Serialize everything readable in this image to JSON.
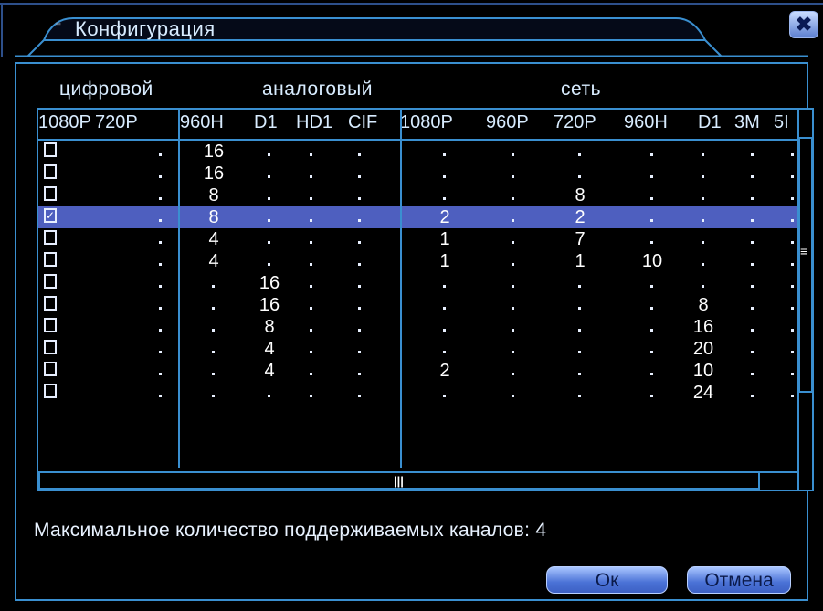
{
  "window": {
    "title": "Конфигурация",
    "close_label": "✖"
  },
  "groups": {
    "digital": "цифровой",
    "analog": "аналоговый",
    "network": "сеть"
  },
  "columns": [
    "1080P",
    "720P",
    "960H",
    "D1",
    "HD1",
    "CIF",
    "1080P",
    "960P",
    "720P",
    "960H",
    "D1",
    "3M",
    "5I"
  ],
  "rows": [
    {
      "checked": false,
      "values": [
        "",
        "",
        "16",
        "",
        "",
        "",
        "",
        "",
        "",
        "",
        "",
        "",
        ""
      ]
    },
    {
      "checked": false,
      "values": [
        "",
        "",
        "16",
        "",
        "",
        "",
        "",
        "",
        "",
        "",
        "",
        "",
        ""
      ]
    },
    {
      "checked": false,
      "values": [
        "",
        "",
        "8",
        "",
        "",
        "",
        "",
        "",
        "8",
        "",
        "",
        "",
        ""
      ]
    },
    {
      "checked": true,
      "values": [
        "",
        "",
        "8",
        "",
        "",
        "",
        "2",
        "",
        "2",
        "",
        "",
        "",
        ""
      ]
    },
    {
      "checked": false,
      "values": [
        "",
        "",
        "4",
        "",
        "",
        "",
        "1",
        "",
        "7",
        "",
        "",
        "",
        ""
      ]
    },
    {
      "checked": false,
      "values": [
        "",
        "",
        "4",
        "",
        "",
        "",
        "1",
        "",
        "1",
        "10",
        "",
        "",
        ""
      ]
    },
    {
      "checked": false,
      "values": [
        "",
        "",
        "",
        "16",
        "",
        "",
        "",
        "",
        "",
        "",
        "",
        "",
        ""
      ]
    },
    {
      "checked": false,
      "values": [
        "",
        "",
        "",
        "16",
        "",
        "",
        "",
        "",
        "",
        "",
        "8",
        "",
        ""
      ]
    },
    {
      "checked": false,
      "values": [
        "",
        "",
        "",
        "8",
        "",
        "",
        "",
        "",
        "",
        "",
        "16",
        "",
        ""
      ]
    },
    {
      "checked": false,
      "values": [
        "",
        "",
        "",
        "4",
        "",
        "",
        "",
        "",
        "",
        "",
        "20",
        "",
        ""
      ]
    },
    {
      "checked": false,
      "values": [
        "",
        "",
        "",
        "4",
        "",
        "",
        "2",
        "",
        "",
        "",
        "10",
        "",
        ""
      ]
    },
    {
      "checked": false,
      "values": [
        "",
        "",
        "",
        "",
        "",
        "",
        "",
        "",
        "",
        "",
        "24",
        "",
        ""
      ]
    }
  ],
  "status_text": "Максимальное количество поддерживаемых каналов: 4",
  "buttons": {
    "ok": "Ок",
    "cancel": "Отмена"
  },
  "colors": {
    "accent_blue": "#3a8fd0",
    "selection": "#4e5fbf",
    "button": "#4a72d6"
  }
}
